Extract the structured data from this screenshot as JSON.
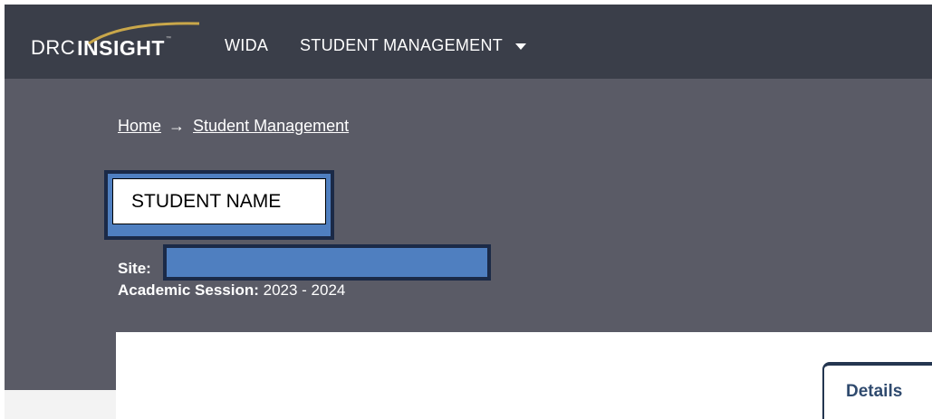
{
  "header": {
    "logo": {
      "drc": "DRC",
      "insight": "INSIGHT",
      "tm": "™"
    },
    "nav": {
      "wida": "WIDA",
      "student_management": "STUDENT MANAGEMENT"
    }
  },
  "breadcrumb": {
    "home": "Home",
    "separator": "→",
    "current": "Student Management"
  },
  "student": {
    "name_placeholder": "STUDENT NAME",
    "site_label": "Site:",
    "session_label": "Academic Session:",
    "session_value": "2023 - 2024"
  },
  "tabs": {
    "details": "Details"
  },
  "colors": {
    "nav_bg": "#3a3e49",
    "hero_bg": "#5a5b66",
    "redaction": "#4f7fc0",
    "accent_tab": "#243650"
  }
}
